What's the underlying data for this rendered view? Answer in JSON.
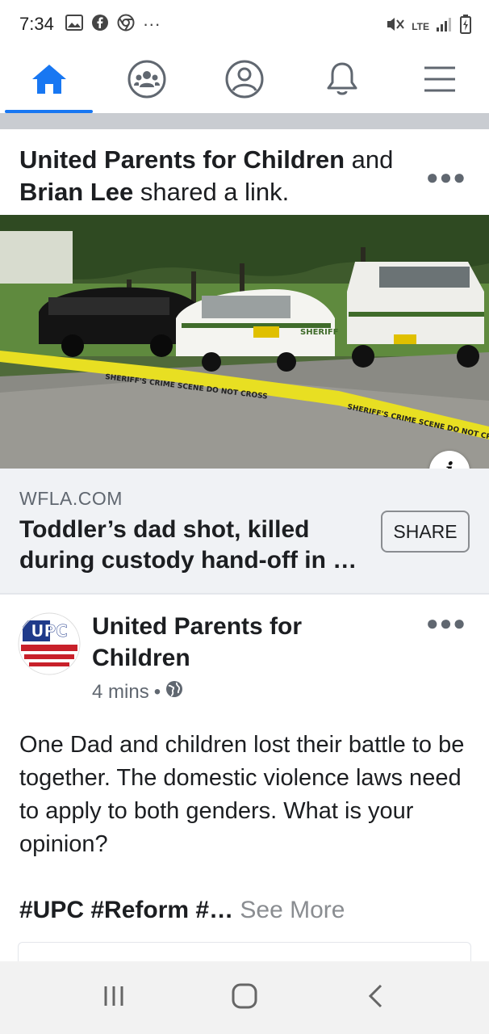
{
  "status_bar": {
    "time": "7:34",
    "overflow": "···",
    "network": "LTE",
    "icons": [
      "gallery-icon",
      "facebook-icon",
      "chrome-icon",
      "mute-icon",
      "signal-icon",
      "battery-icon"
    ]
  },
  "top_nav": {
    "items": [
      {
        "icon": "home-icon",
        "active": true
      },
      {
        "icon": "groups-icon",
        "active": false
      },
      {
        "icon": "profile-icon",
        "active": false
      },
      {
        "icon": "bell-icon",
        "active": false
      },
      {
        "icon": "menu-icon",
        "active": false
      }
    ],
    "accent": "#1877f2"
  },
  "shared": {
    "page_name": "United Parents for Children",
    "conj": " and ",
    "person_name": "Brian Lee",
    "action": " shared a link."
  },
  "link": {
    "domain": "WFLA.COM",
    "title": "Toddler’s dad shot, killed during custody hand-off in …",
    "share_label": "SHARE",
    "info_label": "i",
    "tape_text": "SHERIFF'S CRIME SCENE DO NOT CROSS",
    "car_text": "SHERIFF"
  },
  "post": {
    "author": "United Parents for Children",
    "avatar_text": "UPC",
    "time": "4 mins",
    "separator": " • ",
    "body": "One Dad and children lost their battle to be together. The domestic violence laws need to apply to both genders. What is your opinion?",
    "tags": "#UPC #Reform #…",
    "see_more": " See More"
  },
  "colors": {
    "brand_blue": "#1877f2",
    "text": "#1c1e21",
    "secondary": "#606770",
    "preview_bg": "#f0f2f5"
  }
}
